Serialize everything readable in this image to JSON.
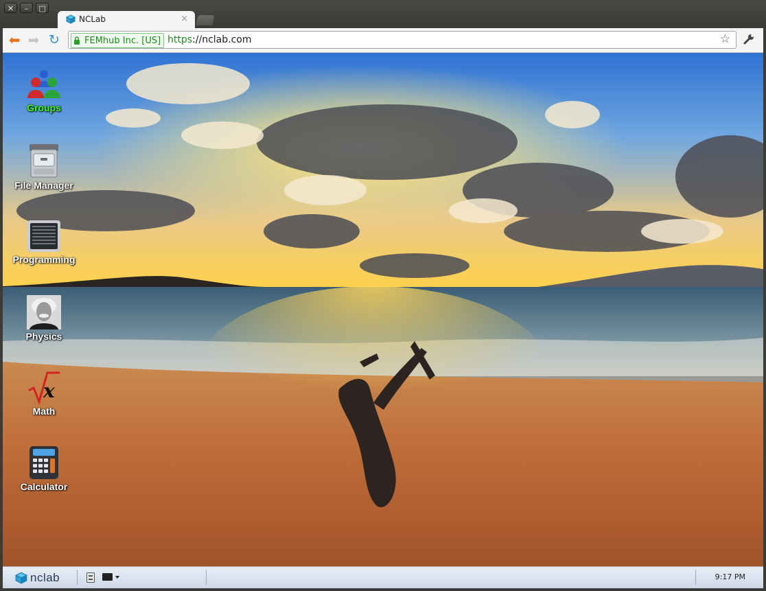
{
  "window": {
    "controls": [
      "close-icon",
      "minimize-icon",
      "maximize-icon"
    ]
  },
  "tab": {
    "title": "NCLab",
    "close_glyph": "×"
  },
  "toolbar": {
    "ev_label": "FEMhub Inc. [US]",
    "url_scheme": "https",
    "url_rest": "://nclab.com"
  },
  "desktop_icons": [
    {
      "label": "Groups",
      "icon": "groups-icon",
      "highlighted": true
    },
    {
      "label": "File Manager",
      "icon": "file-cabinet-icon",
      "highlighted": false
    },
    {
      "label": "Programming",
      "icon": "terminal-icon",
      "highlighted": false
    },
    {
      "label": "Physics",
      "icon": "einstein-portrait-icon",
      "highlighted": false
    },
    {
      "label": "Math",
      "icon": "sqrt-x-icon",
      "highlighted": false
    },
    {
      "label": "Calculator",
      "icon": "calculator-icon",
      "highlighted": false
    }
  ],
  "taskbar": {
    "logo_text": "nclab",
    "clock": "9:17 PM"
  },
  "colors": {
    "accent_green": "#3bff1e",
    "url_green": "#1f8a1f",
    "taskbar": "#dbe3ef"
  }
}
